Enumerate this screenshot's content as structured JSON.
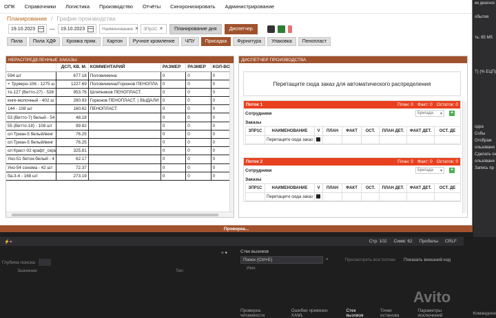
{
  "menu": [
    "ОПК",
    "Справочники",
    "Логистика",
    "Производство",
    "Отчёты",
    "Синхронизировать",
    "Администрирование"
  ],
  "breadcrumb": {
    "active": "Планирование",
    "inactive": "График производства"
  },
  "toolbar": {
    "date_from": "19.10.2023",
    "date_to": "19.10.2023",
    "filter1": "Наименование",
    "filter2": "ЗПр1С",
    "plan_day": "Планирование дня",
    "dispatcher": "Диспетчер"
  },
  "tabs": [
    "Пила",
    "Пила ХДФ",
    "Кромка прям.",
    "Картон",
    "Ручное кромление",
    "ЧПУ",
    "Присадка",
    "Фурнитура",
    "Упаковка",
    "Пенопласт"
  ],
  "active_tab": "Присадка",
  "left_panel": {
    "title": "НЕРАСПРЕДЕЛЕННЫЕ ЗАКАЗЫ",
    "columns": [
      "",
      "ДСП, КВ. М.",
      "КОММЕНТАРИЙ",
      "РАЗМЕР",
      "РАЗМЕР",
      "КОЛ-ВО"
    ],
    "rows": [
      [
        "594 шт",
        "677.18",
        "Половинкина",
        "0",
        "0",
        "0"
      ],
      [
        "+ Труверо-106 - 1275 ш",
        "1227.69",
        "Половинкина/Горюнов ПЕНОПЛА",
        "0",
        "0",
        "0"
      ],
      [
        "то-127 (Витто-27) - 528",
        "953.76",
        "Шляпников ПЕНОПЛАСТ.",
        "0",
        "0",
        "0"
      ],
      [
        "енге-молочный - 402 ш",
        "280.93",
        "Горюнов ПЕНОПЛАСТ. ( ВЫДАЛИ 1",
        "0",
        "0",
        "0"
      ],
      [
        "144 - 108 шт",
        "160.62",
        "ПЕНОПЛАСТ.",
        "0",
        "0",
        "0"
      ],
      [
        "53 (Витто-7) белый - 54",
        "48.18",
        "",
        "0",
        "0",
        "0"
      ],
      [
        "55 (Витто-18) - 108 шт",
        "99.82",
        "",
        "0",
        "0",
        "0"
      ],
      [
        "ол Триан-5 белый/венг",
        "76.25",
        "",
        "0",
        "0",
        "0"
      ],
      [
        "ол Триан-5 белый/венг",
        "76.25",
        "",
        "0",
        "0",
        "0"
      ],
      [
        "ол Краст-02 крафт_серь",
        "325.81",
        "",
        "0",
        "0",
        "0"
      ],
      [
        "Уно-51 бетон-белый - 4",
        "62.17",
        "",
        "0",
        "0",
        "0"
      ],
      [
        "Уно-54 сонома - 42 шт",
        "72.37",
        "",
        "0",
        "0",
        "0"
      ],
      [
        "ба-3-4 - 168 шт",
        "273.19",
        "",
        "0",
        "0",
        "0"
      ]
    ]
  },
  "right_panel": {
    "title": "ДИСПЕТЧЕР ПРОИЗВОДСТВА",
    "dropzone": "Перетащите сюда заказ для автоматического распределения",
    "streams": [
      {
        "name": "Поток 1",
        "plan": "План: 0",
        "fact": "Факт: 0",
        "rest": "Остаток: 0"
      },
      {
        "name": "Поток 2",
        "plan": "План: 0",
        "fact": "Факт: 0",
        "rest": "Остаток: 0"
      }
    ],
    "employees_label": "Сотрудники",
    "brigade_placeholder": "Бригада",
    "orders_label": "Заказы",
    "columns": [
      "ЗПР1С",
      "НАИМЕНОВАНИЕ",
      "V",
      "ПЛАН",
      "ФАКТ",
      "ОСТ.",
      "ПЛАН ДЕТ.",
      "ФАКТ ДЕТ.",
      "ОСТ. ДЕ"
    ],
    "drop_row": "Перетащите сюда заказ"
  },
  "status": "Проверка...",
  "vs_right": [
    "ек диагнос",
    "",
    "обытия",
    "",
    "",
    "ть: 65 Мб",
    "",
    "",
    "",
    "",
    "Т) (% ЕЦП)",
    "",
    "",
    "",
    "",
    "",
    "",
    "",
    "одка",
    "Собы",
    "Отображ",
    "ользовани",
    "Сделать сн",
    "ользовани",
    "Запись пр"
  ],
  "vs_status": {
    "line": "Стр: 102",
    "char": "Симв: 62",
    "mode": "Пробелы",
    "eol": "CRLF"
  },
  "left_bottom": {
    "depth": "Глубина поиска:",
    "value": "Значение",
    "type": "Тип"
  },
  "right_bottom": {
    "title": "Стек вызовов",
    "search": "Поиск (Ctrl+E)",
    "all_threads": "Просмотреть все потоки",
    "external": "Показать внешний код",
    "col": "Имя"
  },
  "bottom_tabs": [
    "Проверка читаемости",
    "Ошибки привязки XAML",
    "Стек вызовов",
    "Точки останова",
    "Параметры исключений",
    "Командное"
  ],
  "bottom_tab_active": "Стек вызовов"
}
